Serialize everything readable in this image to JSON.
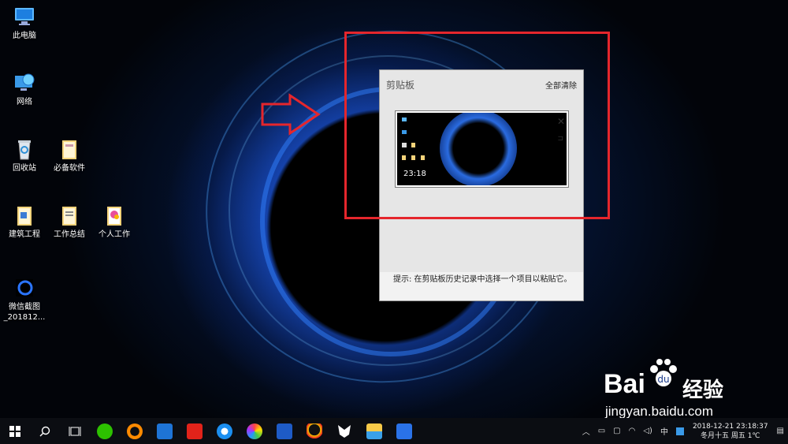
{
  "desktop_icons": [
    {
      "label": "此电脑",
      "icon": "computer-icon"
    },
    {
      "label": "网络",
      "icon": "network-icon"
    },
    {
      "label": "回收站",
      "icon": "recycle-bin-icon"
    },
    {
      "label": "必备软件",
      "icon": "folder-icon"
    },
    {
      "label": "建筑工程",
      "icon": "folder-icon"
    },
    {
      "label": "工作总结",
      "icon": "folder-icon"
    },
    {
      "label": "个人工作",
      "icon": "folder-icon"
    },
    {
      "label": "微信截图_201812...",
      "icon": "image-file-icon"
    }
  ],
  "clipboard": {
    "title": "剪贴板",
    "clear_all": "全部清除",
    "item_time": "23:18",
    "close": "✕",
    "pin": "⊐",
    "tip": "提示: 在剪贴板历史记录中选择一个项目以粘贴它。"
  },
  "taskbar": {
    "tray_input": "中",
    "date_line1": "2018-12-21  23:18:37",
    "date_line2": "冬月十五 周五 1℃"
  },
  "watermark": {
    "brand": "Bai",
    "brand2": "经验",
    "url": "jingyan.baidu.com"
  },
  "colors": {
    "annotation_red": "#e5262c"
  }
}
